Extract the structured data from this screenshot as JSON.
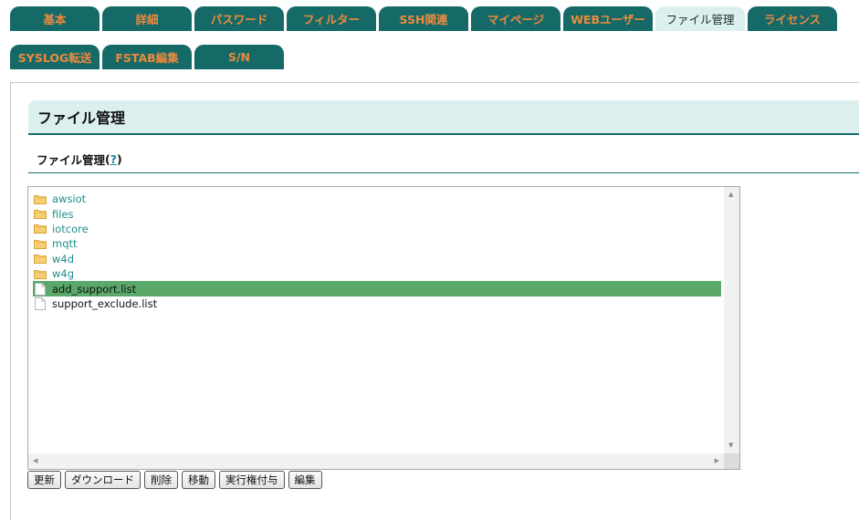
{
  "tabs_row1": [
    {
      "label": "基本",
      "active": false
    },
    {
      "label": "詳細",
      "active": false
    },
    {
      "label": "パスワード",
      "active": false
    },
    {
      "label": "フィルター",
      "active": false
    },
    {
      "label": "SSH関連",
      "active": false
    },
    {
      "label": "マイページ",
      "active": false
    },
    {
      "label": "WEBユーザー",
      "active": false
    },
    {
      "label": "ファイル管理",
      "active": true
    },
    {
      "label": "ライセンス",
      "active": false
    }
  ],
  "tabs_row2": [
    {
      "label": "SYSLOG転送",
      "active": false
    },
    {
      "label": "FSTAB編集",
      "active": false
    },
    {
      "label": "S/N",
      "active": false
    }
  ],
  "page": {
    "title": "ファイル管理",
    "section_title": "ファイル管理",
    "help_open": "(",
    "help_link": "?",
    "help_close": ")"
  },
  "files": [
    {
      "name": "awsiot",
      "type": "folder",
      "selected": false
    },
    {
      "name": "files",
      "type": "folder",
      "selected": false
    },
    {
      "name": "iotcore",
      "type": "folder",
      "selected": false
    },
    {
      "name": "mqtt",
      "type": "folder",
      "selected": false
    },
    {
      "name": "w4d",
      "type": "folder",
      "selected": false
    },
    {
      "name": "w4g",
      "type": "folder",
      "selected": false
    },
    {
      "name": "add_support.list",
      "type": "file",
      "selected": true
    },
    {
      "name": "support_exclude.list",
      "type": "file",
      "selected": false
    }
  ],
  "buttons": {
    "refresh": "更新",
    "download": "ダウンロード",
    "delete": "削除",
    "move": "移動",
    "chmod": "実行権付与",
    "edit": "編集"
  },
  "colors": {
    "tab_bg": "#156a68",
    "tab_text": "#ee8a3c",
    "active_tab_bg": "#dcefef",
    "selected_row": "#5aa86a",
    "folder_text": "#1e8e8a"
  }
}
